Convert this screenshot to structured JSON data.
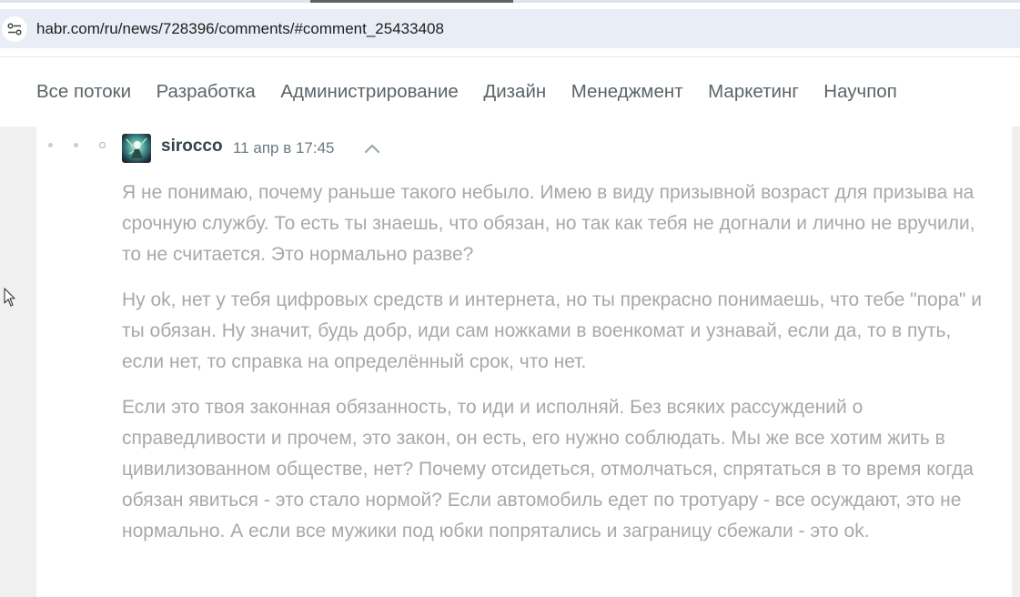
{
  "browser": {
    "url": "habr.com/ru/news/728396/comments/#comment_25433408",
    "site_info_icon": "tune-icon"
  },
  "nav": {
    "items": [
      {
        "label": "Все потоки"
      },
      {
        "label": "Разработка"
      },
      {
        "label": "Администрирование"
      },
      {
        "label": "Дизайн"
      },
      {
        "label": "Менеджмент"
      },
      {
        "label": "Маркетинг"
      },
      {
        "label": "Научпоп"
      }
    ]
  },
  "comment": {
    "author": "sirocco",
    "time": "11 апр в 17:45",
    "paragraphs": [
      "Я не понимаю, почему раньше такого небыло. Имею в виду призывной возраст для призыва на срочную службу. То есть ты знаешь, что обязан, но так как тебя не догнали и лично не вручили, то не считается. Это нормально разве?",
      "Ну ok, нет у тебя цифровых средств и интернета, но ты прекрасно понимаешь, что тебе \"пора\" и ты обязан. Ну значит, будь добр, иди сам ножками в военкомат и узнавай, если да, то в путь, если нет, то справка на определённый срок, что нет.",
      "Если это твоя законная обязанность, то иди и исполняй. Без всяких рассуждений о справедливости и прочем, это закон, он есть, его нужно соблюдать. Мы же все хотим жить в цивилизованном обществе, нет? Почему отсидеться, отмолчаться, спрятаться в то время когда обязан явиться - это стало нормой? Если автомобиль едет по тротуару - все осуждают, это не нормально. А если все мужики под юбки попрятались и заграницу сбежали - это ok."
    ]
  },
  "colors": {
    "comment_text": "#a8a8a8",
    "nav_text": "#5b6469",
    "username": "#33444b",
    "page_bg": "#f0f0f0"
  }
}
